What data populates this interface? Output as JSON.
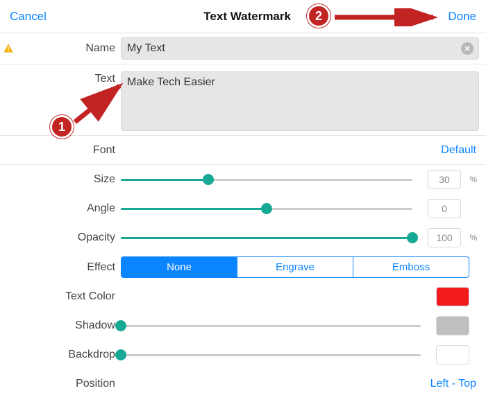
{
  "header": {
    "cancel": "Cancel",
    "title": "Text Watermark",
    "done": "Done"
  },
  "name": {
    "label": "Name",
    "value": "My Text"
  },
  "text": {
    "label": "Text",
    "value": "Make Tech Easier"
  },
  "font": {
    "label": "Font",
    "value": "Default"
  },
  "size": {
    "label": "Size",
    "value": "30",
    "unit": "%",
    "percent": 30
  },
  "angle": {
    "label": "Angle",
    "value": "0",
    "percent": 50
  },
  "opacity": {
    "label": "Opacity",
    "value": "100",
    "unit": "%",
    "percent": 100
  },
  "effect": {
    "label": "Effect",
    "options": [
      "None",
      "Engrave",
      "Emboss"
    ],
    "selected": 0
  },
  "textcolor": {
    "label": "Text Color",
    "color": "#f21b1b"
  },
  "shadow": {
    "label": "Shadow",
    "percent": 0,
    "color": "#bfbfbf"
  },
  "backdrop": {
    "label": "Backdrop",
    "percent": 0,
    "color": "#ffffff"
  },
  "position": {
    "label": "Position",
    "value": "Left - Top"
  },
  "annotations": {
    "one": "1",
    "two": "2"
  }
}
